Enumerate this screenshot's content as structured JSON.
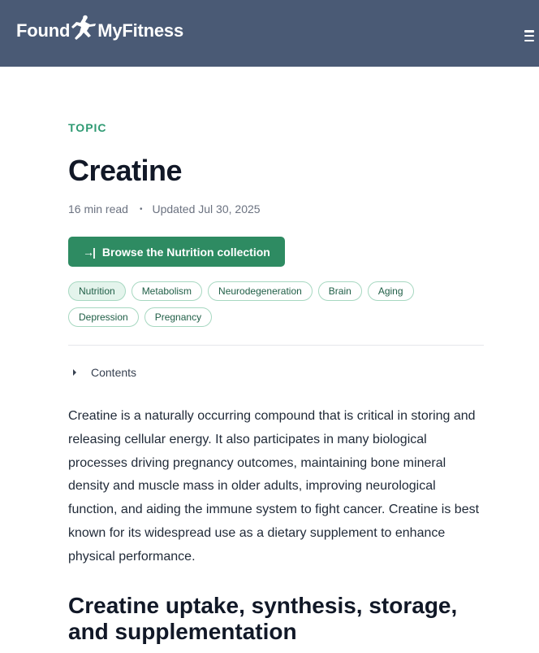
{
  "header": {
    "logo_left": "Found",
    "logo_right": "MyFitness",
    "menu_icon": "hamburger-icon",
    "colors": {
      "background": "#4a5a75",
      "text": "#ffffff"
    }
  },
  "article": {
    "eyebrow": "TOPIC",
    "title": "Creatine",
    "read_time": "16 min read",
    "separator": "•",
    "updated": "Updated Jul 30, 2025",
    "collection_button": {
      "icon": "arrow-right-to-bar-icon",
      "label": "Browse the Nutrition collection"
    },
    "tags": [
      "Nutrition",
      "Metabolism",
      "Neurodegeneration",
      "Brain",
      "Aging",
      "Depression",
      "Pregnancy"
    ],
    "contents_label": "Contents",
    "intro": "Creatine is a naturally occurring compound that is critical in storing and releasing cellular energy. It also participates in many biological processes driving pregnancy outcomes, maintaining bone mineral density and muscle mass in older adults, improving neurological function, and aiding the immune system to fight cancer. Creatine is best known for its widespread use as a dietary supplement to enhance physical performance.",
    "section_heading": "Creatine uptake, synthesis, storage, and supplementation"
  },
  "colors": {
    "accent": "#2f9a73",
    "button": "#2e8b62",
    "tag_border": "#a7d8c1",
    "tag_active_bg": "#e4f4ec"
  }
}
